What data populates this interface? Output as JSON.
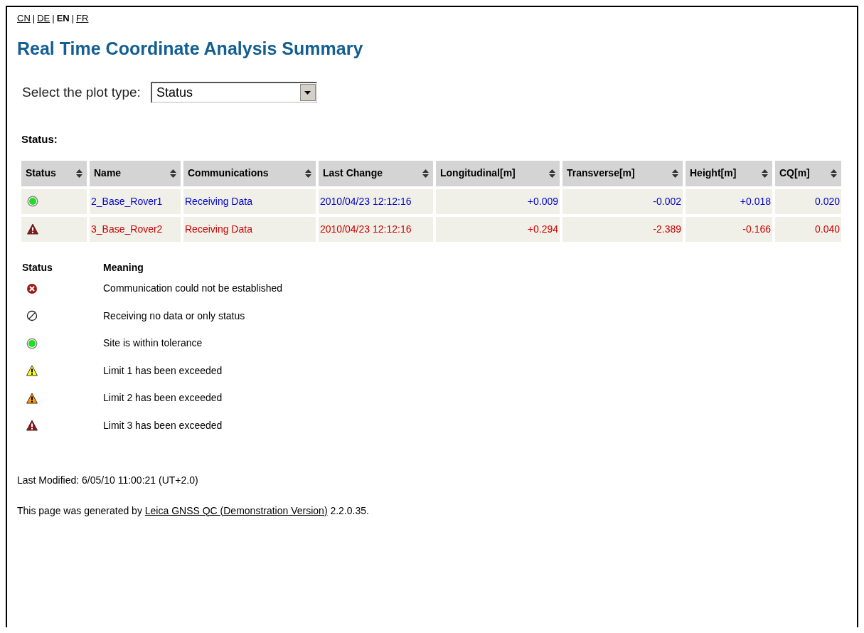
{
  "languages": [
    {
      "label": "CN",
      "selected": false
    },
    {
      "label": "DE",
      "selected": false
    },
    {
      "label": "EN",
      "selected": true
    },
    {
      "label": "FR",
      "selected": false
    }
  ],
  "language_separator": "|",
  "title": "Real Time Coordinate Analysis Summary",
  "plot_select": {
    "label": "Select the plot type:",
    "value": "Status"
  },
  "status_heading": "Status:",
  "table": {
    "columns": [
      "Status",
      "Name",
      "Communications",
      "Last Change",
      "Longitudinal[m]",
      "Transverse[m]",
      "Height[m]",
      "CQ[m]"
    ],
    "rows": [
      {
        "color": "#0000cc",
        "cells": [
          {
            "kind": "ok"
          },
          "2_Base_Rover1",
          "Receiving Data",
          "2010/04/23 12:12:16",
          "+0.009",
          "-0.002",
          "+0.018",
          "0.020"
        ]
      },
      {
        "color": "#cc0000",
        "cells": [
          {
            "kind": "limit3"
          },
          "3_Base_Rover2",
          "Receiving Data",
          "2010/04/23 12:12:16",
          "+0.294",
          "-2.389",
          "-0.166",
          "0.040"
        ]
      }
    ]
  },
  "legend": {
    "columns": [
      "Status",
      "Meaning"
    ],
    "items": [
      {
        "kind": "error",
        "meaning": "Communication could not be established"
      },
      {
        "kind": "none",
        "meaning": "Receiving no data or only status"
      },
      {
        "kind": "ok",
        "meaning": "Site is within tolerance"
      },
      {
        "kind": "limit1",
        "meaning": "Limit 1 has been exceeded"
      },
      {
        "kind": "limit2",
        "meaning": "Limit 2 has been exceeded"
      },
      {
        "kind": "limit3",
        "meaning": "Limit 3 has been exceeded"
      }
    ]
  },
  "last_modified": "Last Modified: 6/05/10 11:00:21 (UT+2.0)",
  "footer": {
    "before": "This page was generated by",
    "link": "Leica GNSS QC (Demonstration Version)",
    "after": "2.2.0.35."
  }
}
